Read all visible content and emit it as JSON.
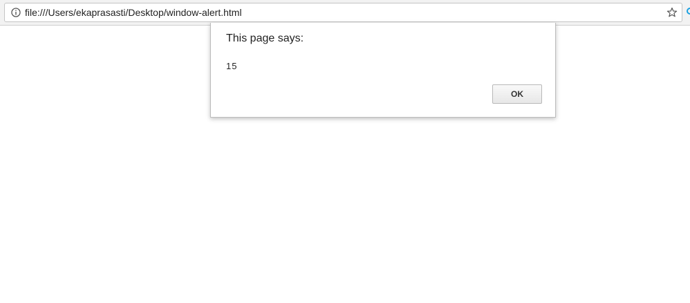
{
  "browser": {
    "url": "file:///Users/ekaprasasti/Desktop/window-alert.html"
  },
  "alert": {
    "title": "This page says:",
    "message": "15",
    "ok_label": "OK"
  },
  "icons": {
    "info": "info-icon",
    "bookmark": "star-icon",
    "extension": "extension-icon"
  },
  "colors": {
    "extension_accent": "#1aa0e0"
  }
}
